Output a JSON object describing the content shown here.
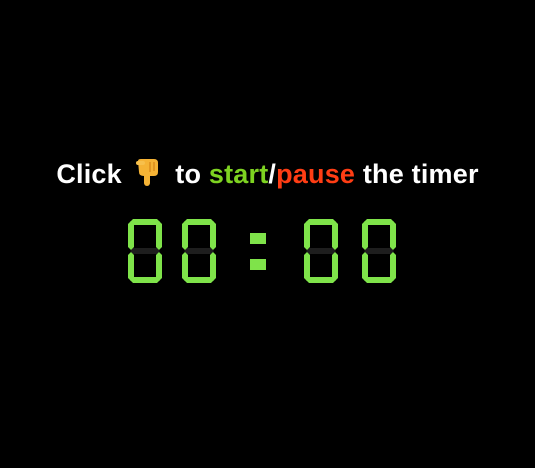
{
  "instruction": {
    "prefix": "Click",
    "pointer_icon": "pointing-down-hand-icon",
    "middle": "to",
    "start_word": "start",
    "separator": "/",
    "pause_word": "pause",
    "suffix": "the timer"
  },
  "timer": {
    "display": "00:00",
    "minutes": "00",
    "seconds": "00",
    "separator": ":"
  },
  "colors": {
    "background": "#000000",
    "text": "#ffffff",
    "start": "#7ed321",
    "pause": "#ff3d14",
    "digit_on": "#7fe34a",
    "digit_off": "#1e1e1e",
    "hand_skin": "#f5b335"
  }
}
